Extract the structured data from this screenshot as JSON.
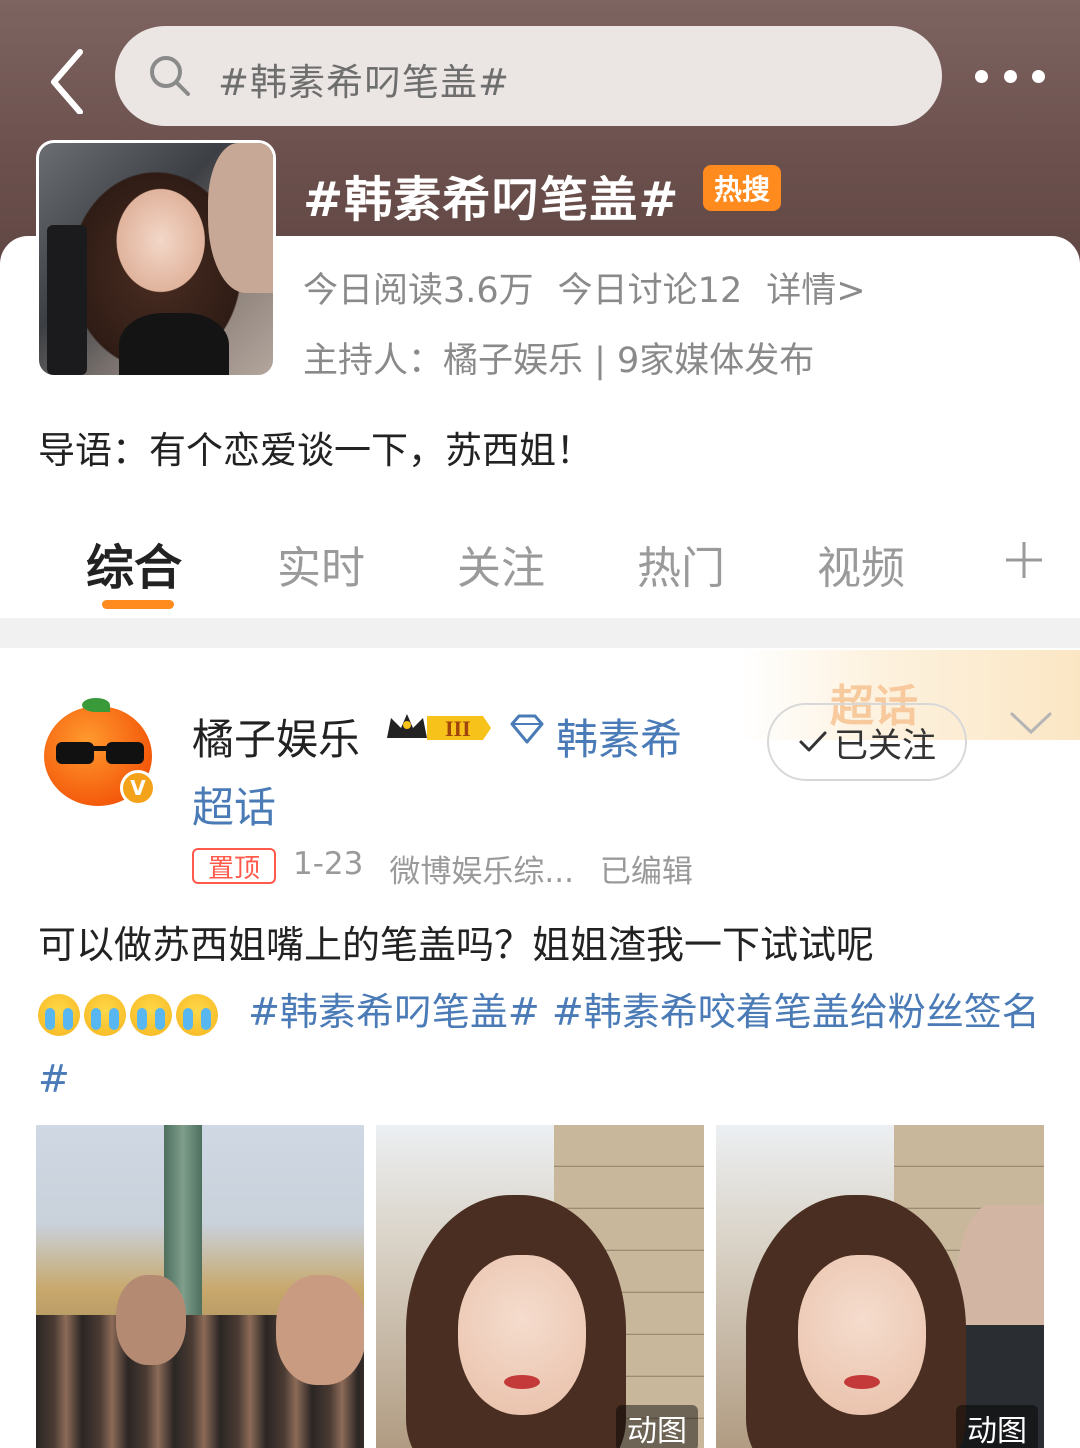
{
  "header": {
    "search_text": "#韩素希叼笔盖#",
    "topic_title": "#韩素希叼笔盖#",
    "hot_badge": "热搜"
  },
  "topic": {
    "read_today": "今日阅读3.6万",
    "discuss_today": "今日讨论12",
    "details": "详情>",
    "host": "主持人：橘子娱乐 | 9家媒体发布",
    "intro": "导语：有个恋爱谈一下，苏西姐！"
  },
  "tabs": [
    {
      "label": "综合",
      "active": true
    },
    {
      "label": "实时",
      "active": false
    },
    {
      "label": "关注",
      "active": false
    },
    {
      "label": "热门",
      "active": false
    },
    {
      "label": "视频",
      "active": false
    }
  ],
  "post": {
    "username": "橘子娱乐",
    "level_badge": "III",
    "super_topic_line1": "韩素希",
    "super_topic_line2": "超话",
    "banner_text": "超话",
    "follow_label": "已关注",
    "pin_label": "置顶",
    "date": "1-23",
    "source": "微博娱乐综...",
    "edited": "已编辑",
    "text": "可以做苏西姐嘴上的笔盖吗？姐姐渣我一下试试呢",
    "tag1": "#韩素希叼笔盖#",
    "tag2": "#韩素希咬着笔盖给粉丝签名#",
    "gif_label": "动图",
    "gif_label_2": "动图"
  },
  "colors": {
    "header_bg": "#6b504d",
    "accent_orange": "#ff8a1d",
    "link_blue": "#4a7bb7",
    "pin_red": "#ff5a4a"
  },
  "icons": [
    "back-arrow-icon",
    "search-icon",
    "more-dots-icon",
    "plus-icon",
    "diamond-icon",
    "crown-icon",
    "check-icon",
    "chevron-down-icon",
    "crying-emoji-icon"
  ]
}
